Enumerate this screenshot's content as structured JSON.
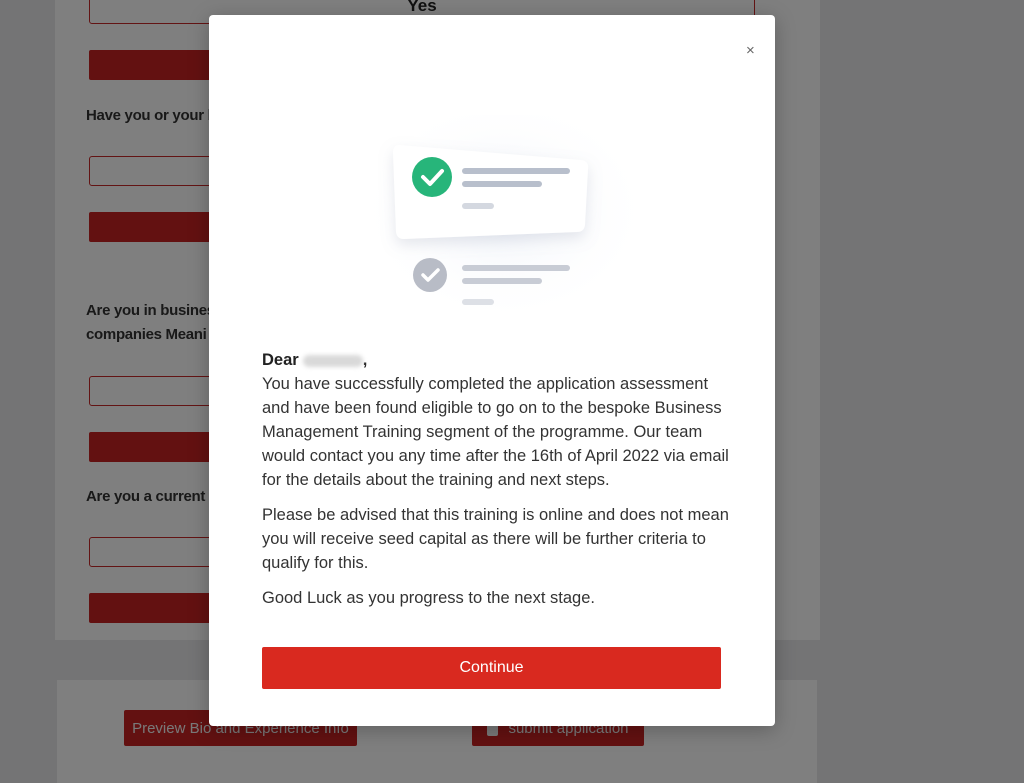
{
  "background_form": {
    "first_field_value": "Yes",
    "questions": [
      "Have you or your b",
      "Are you in busines",
      "companies Meani",
      "Are you a current c"
    ]
  },
  "footer": {
    "preview_label": "Preview Bio and Experience Info",
    "submit_label": "submit application",
    "submit_icon": "lock-icon"
  },
  "modal": {
    "close_label": "×",
    "greeting_prefix": "Dear",
    "greeting_suffix": ",",
    "paragraph1": "You have successfully completed the application assessment and have been found eligible to go on to the bespoke Business Management Training segment of the programme. Our team would contact you any time after the 16th of April 2022 via email for the details about the training and next steps.",
    "paragraph2": "Please be advised that this training is online and does not mean you will receive seed capital as there will be further criteria to qualify for this.",
    "paragraph3": "Good Luck as you progress to the next stage.",
    "continue_label": "Continue",
    "illustration": "checklist-illustration"
  },
  "colors": {
    "accent": "#d9291f",
    "check_green": "#27b57a",
    "check_grey": "#b8bcc6"
  }
}
